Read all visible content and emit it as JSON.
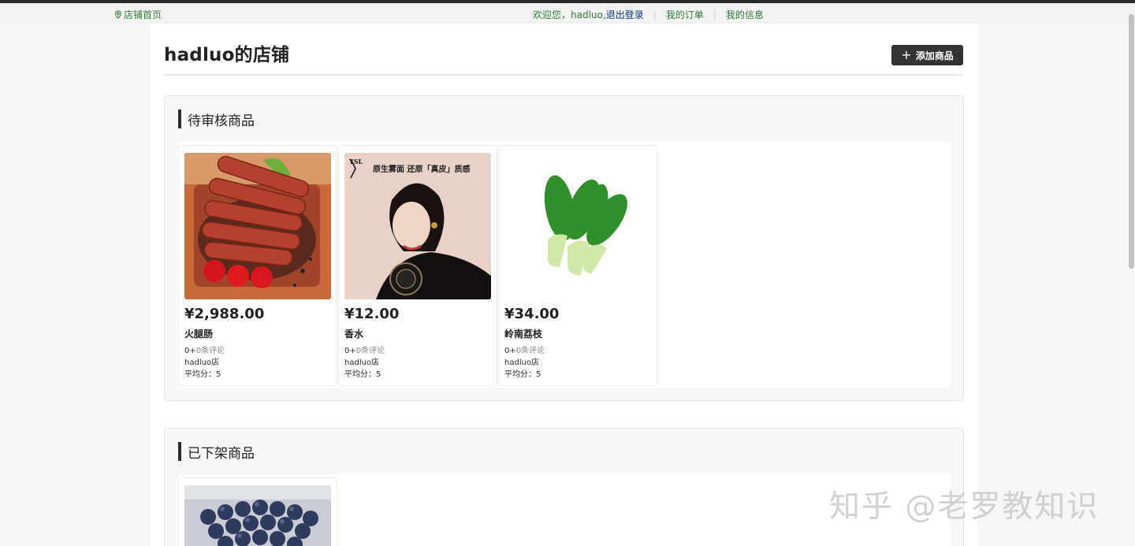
{
  "topbar": {
    "home_link": "店铺首页",
    "welcome": "欢迎您，hadluo,",
    "logout": "退出登录",
    "separator": "|",
    "my_orders": "我的订单",
    "my_info": "我的信息"
  },
  "shop": {
    "title": "hadluo的店铺",
    "add_button": "添加商品"
  },
  "pending": {
    "title": "待审核商品",
    "products": [
      {
        "price": "¥2,988.00",
        "name": "火腿肠",
        "rating_prefix": "0+",
        "reviews": "0条评论",
        "store": "hadluo店",
        "avg": "平均分：5",
        "image": "sausage-photo"
      },
      {
        "price": "¥12.00",
        "name": "香水",
        "rating_prefix": "0+",
        "reviews": "0条评论",
        "store": "hadluo店",
        "avg": "平均分：5",
        "image": "ysl-cushion-ad-photo",
        "ad_text": "原生雾面 还原「真皮」质感",
        "brand_mark": "YSL"
      },
      {
        "price": "¥34.00",
        "name": "岭南荔枝",
        "rating_prefix": "0+",
        "reviews": "0条评论",
        "store": "hadluo店",
        "avg": "平均分：5",
        "image": "bok-choy-photo"
      }
    ]
  },
  "offline": {
    "title": "已下架商品",
    "products": [
      {
        "image": "blueberries-photo"
      }
    ]
  },
  "watermark": "知乎 @老罗教知识",
  "colors": {
    "link_green": "#2e7d32",
    "logout_blue": "#0b3a8f",
    "button_dark": "#333333"
  }
}
